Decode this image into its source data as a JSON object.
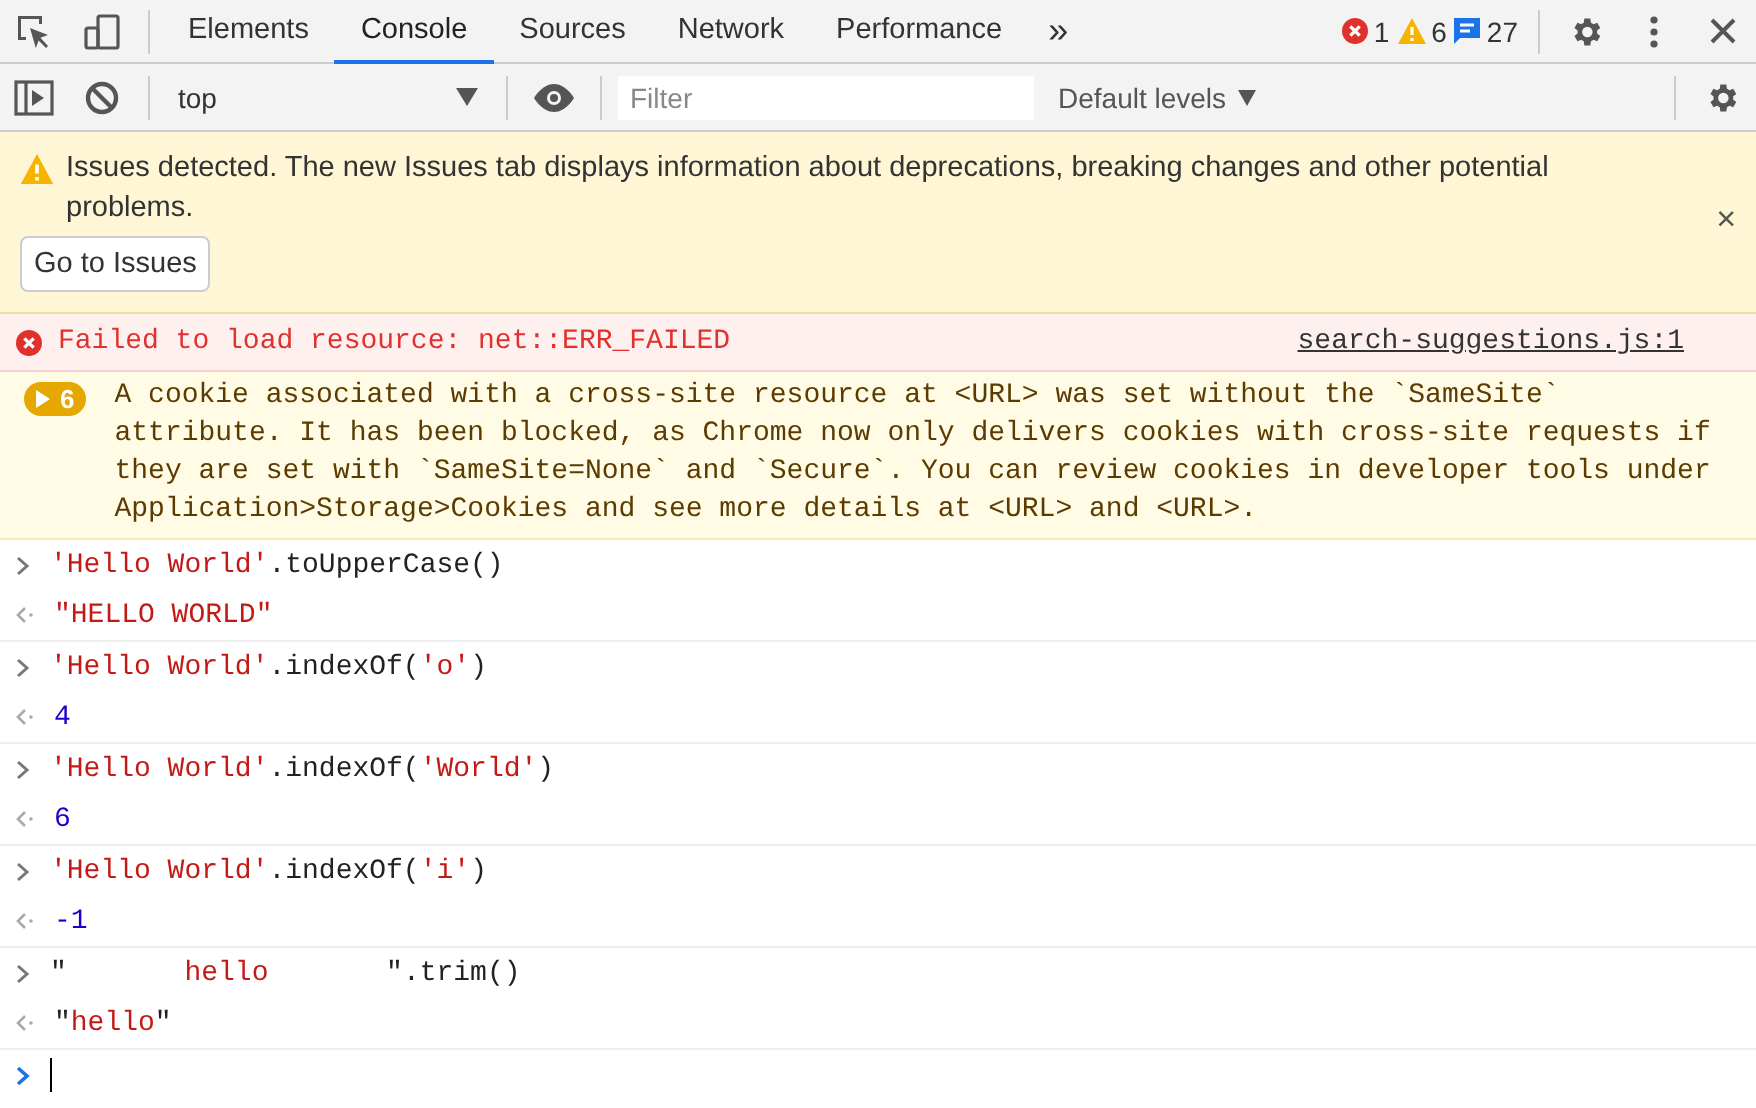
{
  "tabs": [
    {
      "label": "Elements",
      "selected": false
    },
    {
      "label": "Console",
      "selected": true
    },
    {
      "label": "Sources",
      "selected": false
    },
    {
      "label": "Network",
      "selected": false
    },
    {
      "label": "Performance",
      "selected": false
    }
  ],
  "more_tabs": "»",
  "counts": {
    "errors": "1",
    "warnings": "6",
    "messages": "27"
  },
  "console_toolbar": {
    "context": "top",
    "filter": {
      "placeholder": "Filter"
    },
    "levels": "Default levels"
  },
  "issues_banner": {
    "text": "Issues detected. The new Issues tab displays information about deprecations, breaking changes and other potential problems.",
    "button": "Go to Issues",
    "close": "×"
  },
  "messages": [
    {
      "kind": "error",
      "text": "Failed to load resource: net::ERR_FAILED",
      "source": "search-suggestions.js:1"
    },
    {
      "kind": "warning",
      "count": "6",
      "text": "A cookie associated with a cross-site resource at <URL> was set without the `SameSite` attribute. It has been blocked, as Chrome now only delivers cookies with cross-site requests if they are set with `SameSite=None` and `Secure`. You can review cookies in developer tools under Application>Storage>Cookies and see more details at <URL> and <URL>."
    }
  ],
  "entries": [
    {
      "input": [
        {
          "kind": "string",
          "text": "'Hello World'"
        },
        {
          "kind": "plain",
          "text": ".toUpperCase()"
        }
      ],
      "result": [
        {
          "kind": "string",
          "text": "\"HELLO WORLD\""
        }
      ]
    },
    {
      "input": [
        {
          "kind": "string",
          "text": "'Hello World'"
        },
        {
          "kind": "plain",
          "text": ".indexOf("
        },
        {
          "kind": "string",
          "text": "'o'"
        },
        {
          "kind": "plain",
          "text": ")"
        }
      ],
      "result": [
        {
          "kind": "number",
          "text": "4"
        }
      ]
    },
    {
      "input": [
        {
          "kind": "string",
          "text": "'Hello World'"
        },
        {
          "kind": "plain",
          "text": ".indexOf("
        },
        {
          "kind": "string",
          "text": "'World'"
        },
        {
          "kind": "plain",
          "text": ")"
        }
      ],
      "result": [
        {
          "kind": "number",
          "text": "6"
        }
      ]
    },
    {
      "input": [
        {
          "kind": "string",
          "text": "'Hello World'"
        },
        {
          "kind": "plain",
          "text": ".indexOf("
        },
        {
          "kind": "string",
          "text": "'i'"
        },
        {
          "kind": "plain",
          "text": ")"
        }
      ],
      "result": [
        {
          "kind": "number",
          "text": "-1"
        }
      ]
    },
    {
      "input": [
        {
          "kind": "plain",
          "text": "\""
        },
        {
          "kind": "string",
          "text": "       hello       "
        },
        {
          "kind": "plain",
          "text": "\".trim()"
        }
      ],
      "result": [
        {
          "kind": "plain",
          "text": "\""
        },
        {
          "kind": "string",
          "text": "hello"
        },
        {
          "kind": "plain",
          "text": "\""
        }
      ]
    }
  ]
}
